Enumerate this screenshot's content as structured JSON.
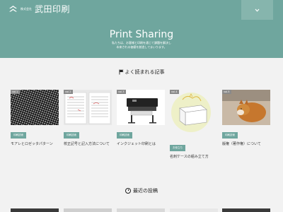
{
  "header": {
    "logo_sub": "株式会社",
    "logo_name": "武田印刷",
    "menu_icon": "chevron-down-icon",
    "title": "Print Sharing",
    "desc_line1": "私たちは、お客様と印刷を通じて課題を解決し",
    "desc_line2": "本来される価値を創造してまいります。"
  },
  "popular": {
    "heading": "よく読まれる記事",
    "items": [
      {
        "vol": "vol.1",
        "badge": "印刷技術",
        "title": "モアレとロゼッタパターン"
      },
      {
        "vol": "vol.2",
        "badge": "印刷技術",
        "title": "校正記号と記入方法について"
      },
      {
        "vol": "vol.3",
        "badge": "印刷技術",
        "title": "インクジェット印刷とは"
      },
      {
        "vol": "vol.4",
        "badge": "お役立ち",
        "title": "名刺ケースの組み立て方"
      },
      {
        "vol": "vol.5",
        "badge": "印刷技術",
        "title": "版権（著作権）について"
      }
    ]
  },
  "recent": {
    "heading": "最近の投稿"
  },
  "colors": {
    "brand": "#6fa69e",
    "background": "#f2f2f2"
  }
}
